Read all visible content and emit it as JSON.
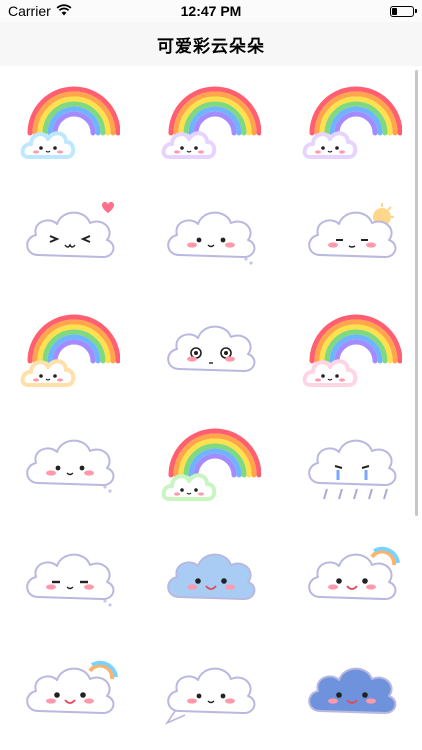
{
  "status_bar": {
    "carrier": "Carrier",
    "time": "12:47 PM",
    "battery_level": 0.3
  },
  "nav": {
    "title": "可爱彩云朵朵"
  },
  "stickers": [
    {
      "name": "rainbow-cloud-sticker",
      "kind": "rainbow",
      "tint": "#bde8ff"
    },
    {
      "name": "rainbow-cloud-sticker",
      "kind": "rainbow",
      "tint": "#e6d4ff"
    },
    {
      "name": "rainbow-cloud-sticker",
      "kind": "rainbow",
      "tint": "#e6d4ff"
    },
    {
      "name": "winking-cloud-sticker",
      "kind": "cloud",
      "face": "wink",
      "extra": "heart"
    },
    {
      "name": "smiling-cloud-sticker",
      "kind": "cloud",
      "face": "smile",
      "extra": "dots"
    },
    {
      "name": "sun-cloud-sticker",
      "kind": "cloud",
      "face": "sleepy",
      "extra": "sun"
    },
    {
      "name": "rainbow-cloud-sticker",
      "kind": "rainbow",
      "tint": "#ffe0a8"
    },
    {
      "name": "surprised-cloud-sticker",
      "kind": "cloud",
      "face": "surprised",
      "extra": "none"
    },
    {
      "name": "rainbow-cloud-sticker",
      "kind": "rainbow",
      "tint": "#ffd4e4"
    },
    {
      "name": "smiling-cloud-sticker",
      "kind": "cloud",
      "face": "smile",
      "extra": "dots"
    },
    {
      "name": "rainbow-cloud-sticker",
      "kind": "rainbow",
      "tint": "#c8f5c0"
    },
    {
      "name": "rain-cloud-sticker",
      "kind": "cloud",
      "face": "cry",
      "extra": "rain"
    },
    {
      "name": "calm-cloud-sticker",
      "kind": "cloud",
      "face": "calm",
      "extra": "dots"
    },
    {
      "name": "blue-cloud-sticker",
      "kind": "cloud",
      "face": "happy",
      "extra": "none",
      "fill": "#a9ccf5"
    },
    {
      "name": "rainbow-face-cloud-sticker",
      "kind": "cloud",
      "face": "happy",
      "extra": "rainbow-ring"
    },
    {
      "name": "rainbow-face-cloud-sticker",
      "kind": "cloud",
      "face": "happy",
      "extra": "rainbow-ring"
    },
    {
      "name": "speech-cloud-sticker",
      "kind": "cloud",
      "face": "smile",
      "extra": "tail"
    },
    {
      "name": "blue-cloud-sticker",
      "kind": "cloud",
      "face": "happy",
      "extra": "none",
      "fill": "#6e93dc"
    }
  ]
}
